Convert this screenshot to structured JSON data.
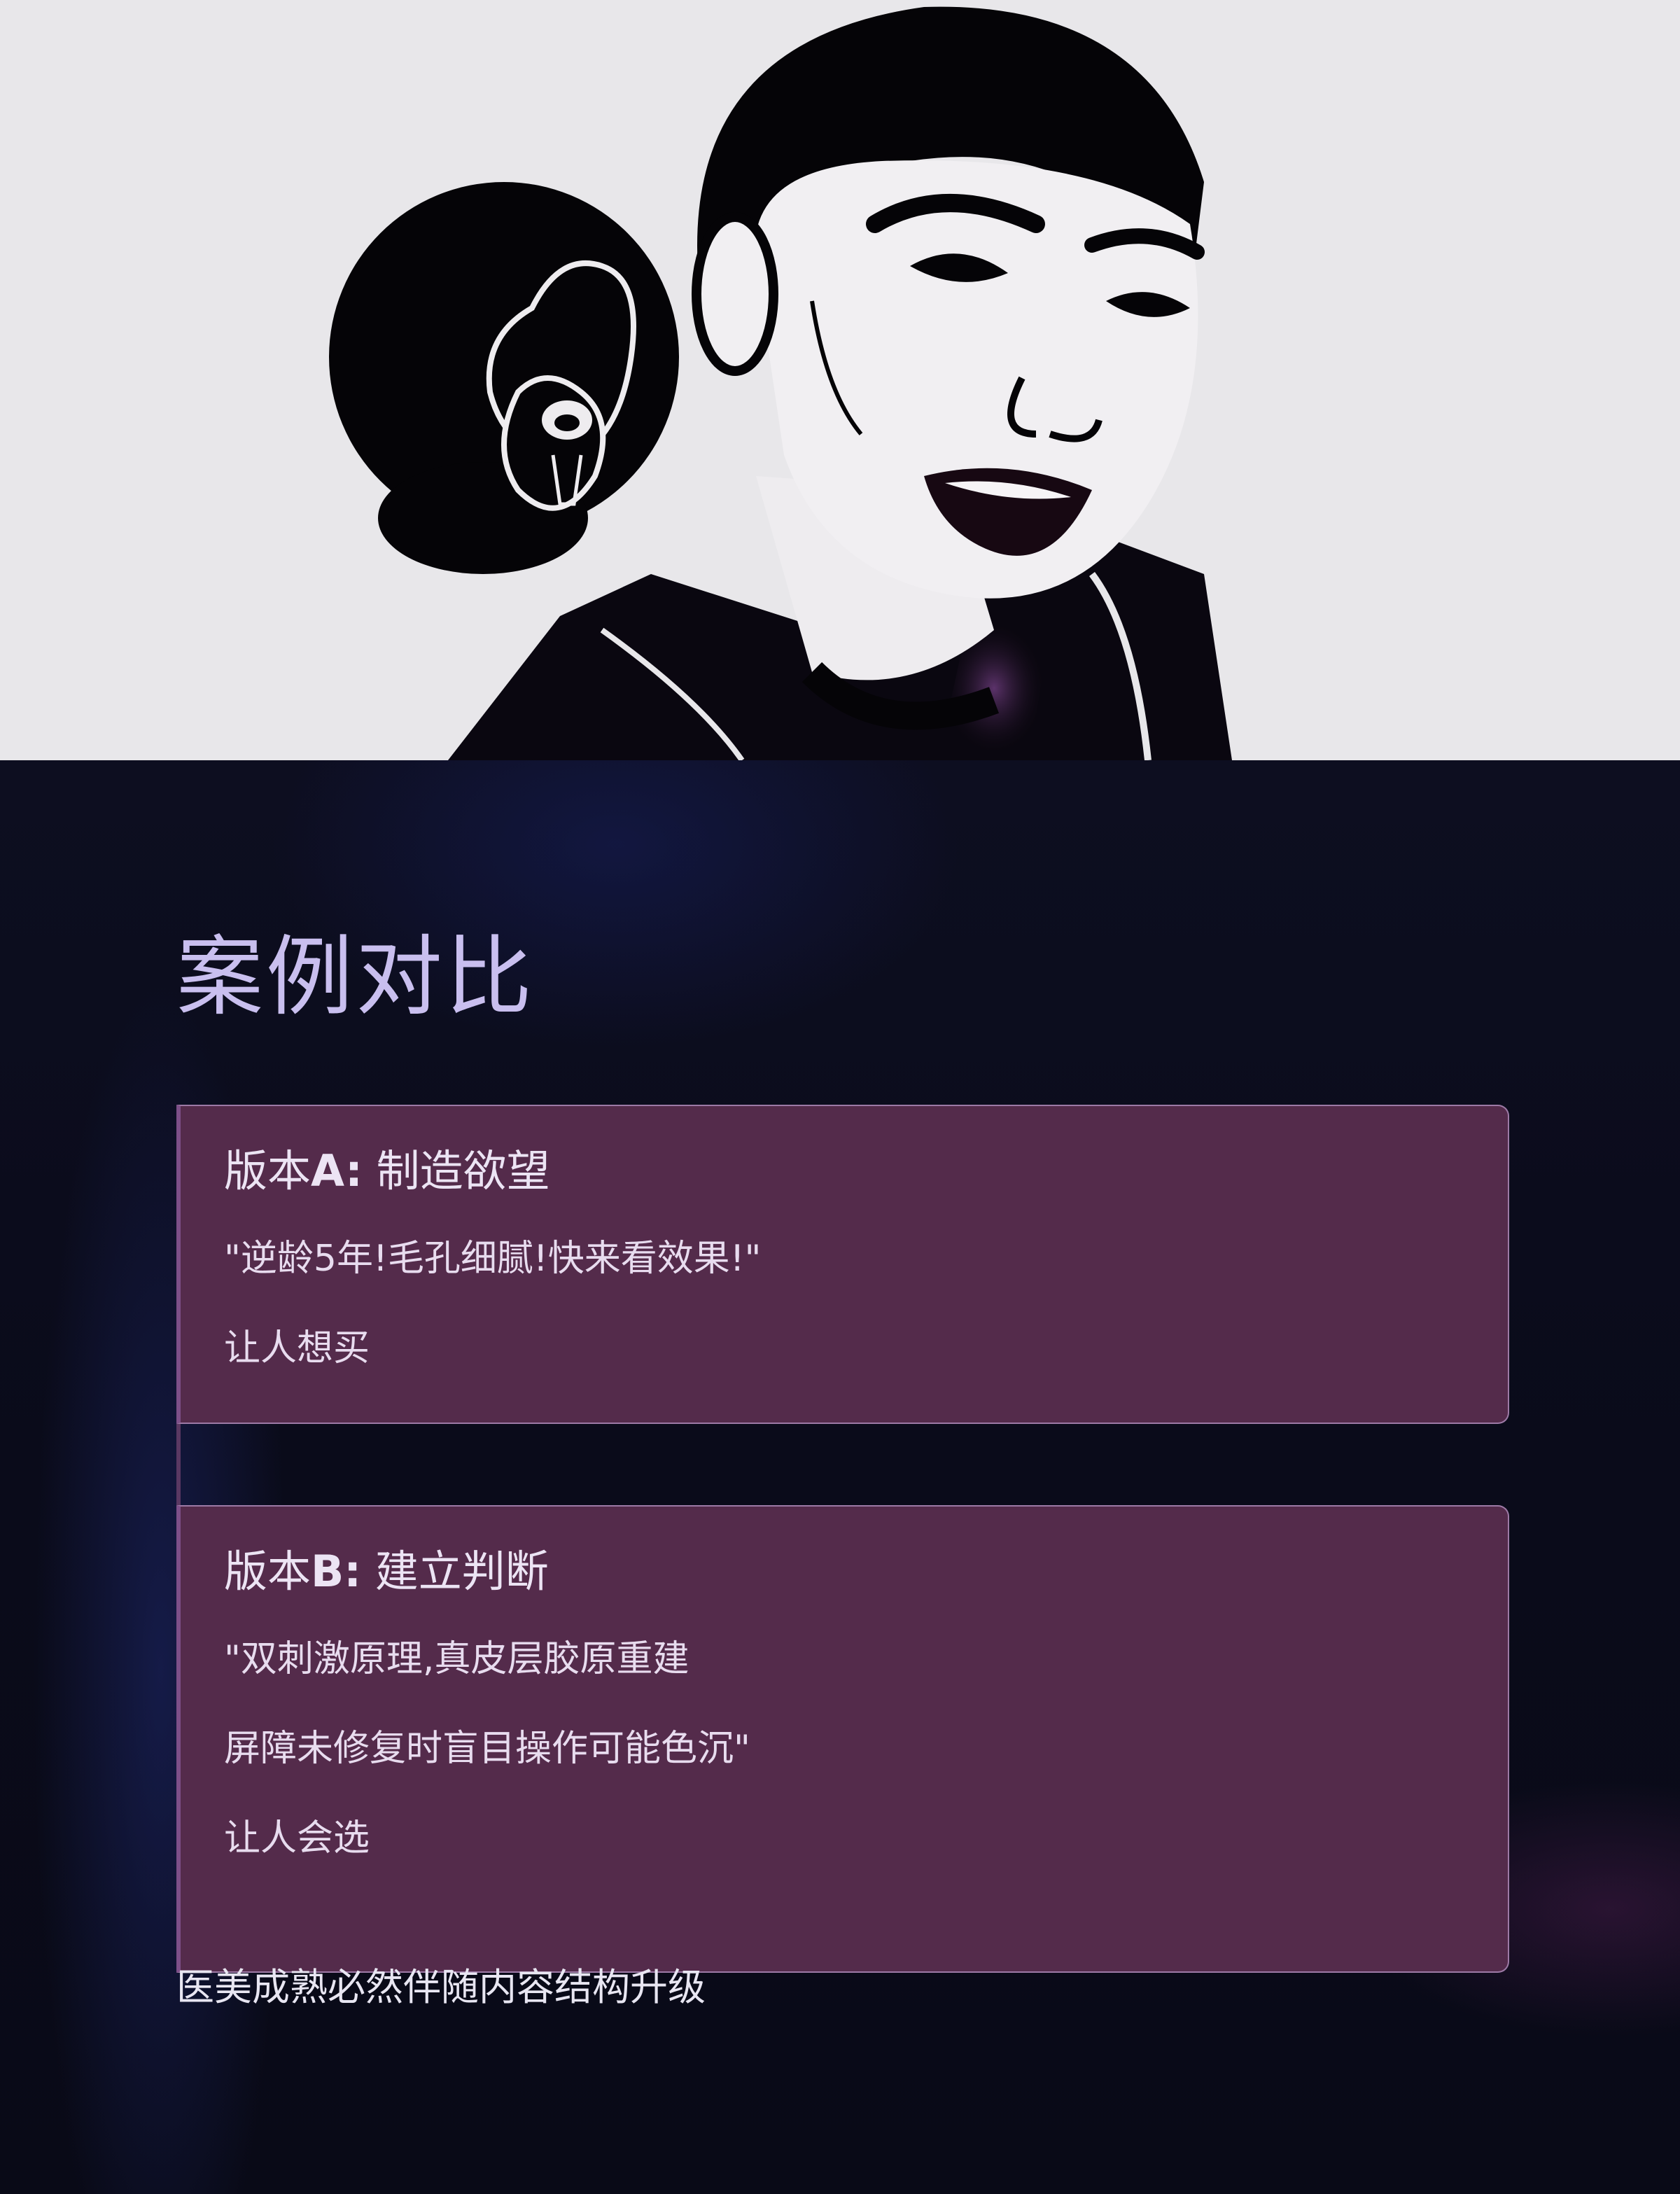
{
  "hero": {
    "illustration": "woman-portrait-with-orchid",
    "background_color": "#e8e7ea"
  },
  "section": {
    "title": "案例对比",
    "title_color": "#c9bfef"
  },
  "cards": [
    {
      "title_prefix": "版本",
      "title_letter": "A:",
      "title_rest": "制造欲望",
      "quote": "\"逆龄5年!毛孔细腻!快来看效果!\"",
      "result": "让人想买"
    },
    {
      "title_prefix": "版本",
      "title_letter": "B:",
      "title_rest": "建立判断",
      "quote_line1": "\"双刺激原理,真皮层胶原重建",
      "quote_line2": "屏障未修复时盲目操作可能色沉\"",
      "result": "让人会选"
    }
  ],
  "footer": {
    "note": "医美成熟必然伴随内容结构升级"
  },
  "colors": {
    "card_bg": "#542b4b",
    "card_border": "#9d7aa6",
    "page_bg": "#0b0c1c"
  }
}
